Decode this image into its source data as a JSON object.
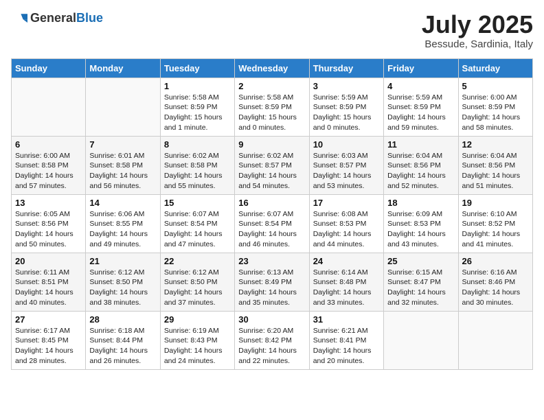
{
  "header": {
    "logo_general": "General",
    "logo_blue": "Blue",
    "month_year": "July 2025",
    "location": "Bessude, Sardinia, Italy"
  },
  "days_of_week": [
    "Sunday",
    "Monday",
    "Tuesday",
    "Wednesday",
    "Thursday",
    "Friday",
    "Saturday"
  ],
  "weeks": [
    [
      {
        "day": "",
        "info": ""
      },
      {
        "day": "",
        "info": ""
      },
      {
        "day": "1",
        "info": "Sunrise: 5:58 AM\nSunset: 8:59 PM\nDaylight: 15 hours\nand 1 minute."
      },
      {
        "day": "2",
        "info": "Sunrise: 5:58 AM\nSunset: 8:59 PM\nDaylight: 15 hours\nand 0 minutes."
      },
      {
        "day": "3",
        "info": "Sunrise: 5:59 AM\nSunset: 8:59 PM\nDaylight: 15 hours\nand 0 minutes."
      },
      {
        "day": "4",
        "info": "Sunrise: 5:59 AM\nSunset: 8:59 PM\nDaylight: 14 hours\nand 59 minutes."
      },
      {
        "day": "5",
        "info": "Sunrise: 6:00 AM\nSunset: 8:59 PM\nDaylight: 14 hours\nand 58 minutes."
      }
    ],
    [
      {
        "day": "6",
        "info": "Sunrise: 6:00 AM\nSunset: 8:58 PM\nDaylight: 14 hours\nand 57 minutes."
      },
      {
        "day": "7",
        "info": "Sunrise: 6:01 AM\nSunset: 8:58 PM\nDaylight: 14 hours\nand 56 minutes."
      },
      {
        "day": "8",
        "info": "Sunrise: 6:02 AM\nSunset: 8:58 PM\nDaylight: 14 hours\nand 55 minutes."
      },
      {
        "day": "9",
        "info": "Sunrise: 6:02 AM\nSunset: 8:57 PM\nDaylight: 14 hours\nand 54 minutes."
      },
      {
        "day": "10",
        "info": "Sunrise: 6:03 AM\nSunset: 8:57 PM\nDaylight: 14 hours\nand 53 minutes."
      },
      {
        "day": "11",
        "info": "Sunrise: 6:04 AM\nSunset: 8:56 PM\nDaylight: 14 hours\nand 52 minutes."
      },
      {
        "day": "12",
        "info": "Sunrise: 6:04 AM\nSunset: 8:56 PM\nDaylight: 14 hours\nand 51 minutes."
      }
    ],
    [
      {
        "day": "13",
        "info": "Sunrise: 6:05 AM\nSunset: 8:56 PM\nDaylight: 14 hours\nand 50 minutes."
      },
      {
        "day": "14",
        "info": "Sunrise: 6:06 AM\nSunset: 8:55 PM\nDaylight: 14 hours\nand 49 minutes."
      },
      {
        "day": "15",
        "info": "Sunrise: 6:07 AM\nSunset: 8:54 PM\nDaylight: 14 hours\nand 47 minutes."
      },
      {
        "day": "16",
        "info": "Sunrise: 6:07 AM\nSunset: 8:54 PM\nDaylight: 14 hours\nand 46 minutes."
      },
      {
        "day": "17",
        "info": "Sunrise: 6:08 AM\nSunset: 8:53 PM\nDaylight: 14 hours\nand 44 minutes."
      },
      {
        "day": "18",
        "info": "Sunrise: 6:09 AM\nSunset: 8:53 PM\nDaylight: 14 hours\nand 43 minutes."
      },
      {
        "day": "19",
        "info": "Sunrise: 6:10 AM\nSunset: 8:52 PM\nDaylight: 14 hours\nand 41 minutes."
      }
    ],
    [
      {
        "day": "20",
        "info": "Sunrise: 6:11 AM\nSunset: 8:51 PM\nDaylight: 14 hours\nand 40 minutes."
      },
      {
        "day": "21",
        "info": "Sunrise: 6:12 AM\nSunset: 8:50 PM\nDaylight: 14 hours\nand 38 minutes."
      },
      {
        "day": "22",
        "info": "Sunrise: 6:12 AM\nSunset: 8:50 PM\nDaylight: 14 hours\nand 37 minutes."
      },
      {
        "day": "23",
        "info": "Sunrise: 6:13 AM\nSunset: 8:49 PM\nDaylight: 14 hours\nand 35 minutes."
      },
      {
        "day": "24",
        "info": "Sunrise: 6:14 AM\nSunset: 8:48 PM\nDaylight: 14 hours\nand 33 minutes."
      },
      {
        "day": "25",
        "info": "Sunrise: 6:15 AM\nSunset: 8:47 PM\nDaylight: 14 hours\nand 32 minutes."
      },
      {
        "day": "26",
        "info": "Sunrise: 6:16 AM\nSunset: 8:46 PM\nDaylight: 14 hours\nand 30 minutes."
      }
    ],
    [
      {
        "day": "27",
        "info": "Sunrise: 6:17 AM\nSunset: 8:45 PM\nDaylight: 14 hours\nand 28 minutes."
      },
      {
        "day": "28",
        "info": "Sunrise: 6:18 AM\nSunset: 8:44 PM\nDaylight: 14 hours\nand 26 minutes."
      },
      {
        "day": "29",
        "info": "Sunrise: 6:19 AM\nSunset: 8:43 PM\nDaylight: 14 hours\nand 24 minutes."
      },
      {
        "day": "30",
        "info": "Sunrise: 6:20 AM\nSunset: 8:42 PM\nDaylight: 14 hours\nand 22 minutes."
      },
      {
        "day": "31",
        "info": "Sunrise: 6:21 AM\nSunset: 8:41 PM\nDaylight: 14 hours\nand 20 minutes."
      },
      {
        "day": "",
        "info": ""
      },
      {
        "day": "",
        "info": ""
      }
    ]
  ]
}
